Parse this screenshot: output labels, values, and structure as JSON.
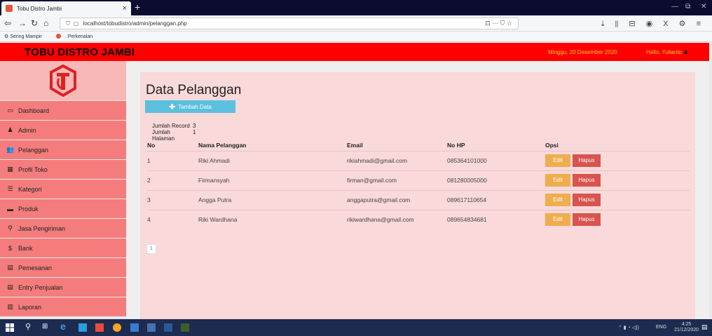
{
  "browser": {
    "tab_title": "Tobu Distro Jambi",
    "tab_close": "×",
    "new_tab": "+",
    "url": "localhost/tobudistro/admin/pelanggan.php",
    "url_end_icons": "⊡   ··· ⛉ ☆",
    "toolbar_icons": "⤓ ⫴ ⊟ ◉ X ⚙ ≡",
    "bookmarks": [
      "Sering Mampir",
      "Perkenalan"
    ]
  },
  "header": {
    "brand": "TOBU DISTRO JAMBI",
    "date": "Minggu, 20 Desember 2020",
    "greeting": "Hallo, Yulianto"
  },
  "sidebar": {
    "items": [
      {
        "label": "Dashboard",
        "icon": "▭"
      },
      {
        "label": "Admin",
        "icon": "♟"
      },
      {
        "label": "Pelanggan",
        "icon": "👥"
      },
      {
        "label": "Profil Toko",
        "icon": "▦"
      },
      {
        "label": "Kategori",
        "icon": "☰"
      },
      {
        "label": "Produk",
        "icon": "▬"
      },
      {
        "label": "Jasa Pengiriman",
        "icon": "⚲"
      },
      {
        "label": "Bank",
        "icon": "$"
      },
      {
        "label": "Pemesanan",
        "icon": "▤"
      },
      {
        "label": "Entry Penjualan",
        "icon": "▤"
      },
      {
        "label": "Laporan",
        "icon": "▥"
      }
    ]
  },
  "main": {
    "title": "Data Pelanggan",
    "add_button": "Tambah Data",
    "stats": {
      "record_label": "Jumlah Record",
      "record_value": "3",
      "pages_label": "Jumlah Halaman",
      "pages_value": "1"
    },
    "columns": [
      "No",
      "Nama Pelanggan",
      "Email",
      "No HP",
      "Opsi"
    ],
    "rows": [
      {
        "no": "1",
        "nama": "Riki Ahmadi",
        "email": "rikiahmadi@gmail.com",
        "hp": "085364101000"
      },
      {
        "no": "2",
        "nama": "Firmansyah",
        "email": "firman@gmail.com",
        "hp": "081280005000"
      },
      {
        "no": "3",
        "nama": "Angga Putra",
        "email": "anggaputra@gmail.com",
        "hp": "089617110654"
      },
      {
        "no": "4",
        "nama": "Riki Wardhana",
        "email": "rikiwardhana@gmail.com",
        "hp": "089654834681"
      }
    ],
    "edit_label": "Edit",
    "delete_label": "Hapus",
    "page": "1"
  },
  "taskbar": {
    "tray": "ENG",
    "time": "4:25",
    "date": "21/12/2020"
  },
  "colors": {
    "header": "#ff0000",
    "sidebar_item": "#f47c7c",
    "panel": "#f9d9d9",
    "add_button": "#5bc0de",
    "edit_button": "#f0ad4e",
    "delete_button": "#d9534f"
  }
}
